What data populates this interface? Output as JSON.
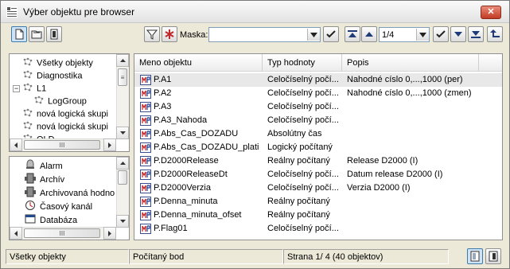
{
  "window": {
    "title": "Výber objektu pre browser",
    "close_label": "✕"
  },
  "toolbar": {
    "mask_label": "Maska:",
    "mask_value": "",
    "page_value": "1/4"
  },
  "tree": {
    "items": [
      {
        "label": "Všetky objekty",
        "icon": "object-group-icon"
      },
      {
        "label": "Diagnostika",
        "icon": "object-group-icon"
      },
      {
        "label": "L1",
        "icon": "object-group-icon",
        "expander": "−"
      },
      {
        "label": "LogGroup",
        "icon": "object-group-icon"
      },
      {
        "label": "nová logická skupi",
        "icon": "object-group-icon"
      },
      {
        "label": "nová logická skupi",
        "icon": "object-group-icon"
      },
      {
        "label": "OLD",
        "icon": "object-group-icon"
      }
    ]
  },
  "types": {
    "items": [
      {
        "label": "Alarm",
        "icon": "alarm-bell-icon"
      },
      {
        "label": "Archív",
        "icon": "archive-icon"
      },
      {
        "label": "Archivovaná hodno",
        "icon": "archive-value-icon"
      },
      {
        "label": "Časový kanál",
        "icon": "time-channel-icon"
      },
      {
        "label": "Databáza",
        "icon": "database-icon"
      }
    ]
  },
  "grid": {
    "columns": [
      "Meno objektu",
      "Typ hodnoty",
      "Popis"
    ],
    "rows": [
      {
        "name": "P.A1",
        "type": "Celočíselný počí...",
        "desc": "Nahodné císlo 0,...,1000 (per)"
      },
      {
        "name": "P.A2",
        "type": "Celočíselný počí...",
        "desc": "Nahodné císlo 0,...,1000 (zmen)"
      },
      {
        "name": "P.A3",
        "type": "Celočíselný počí...",
        "desc": ""
      },
      {
        "name": "P.A3_Nahoda",
        "type": "Celočíselný počí...",
        "desc": ""
      },
      {
        "name": "P.Abs_Cas_DOZADU",
        "type": "Absolútny čas",
        "desc": ""
      },
      {
        "name": "P.Abs_Cas_DOZADU_plati",
        "type": "Logický počítaný",
        "desc": ""
      },
      {
        "name": "P.D2000Release",
        "type": "Reálny počítaný",
        "desc": "Release D2000 (I)"
      },
      {
        "name": "P.D2000ReleaseDt",
        "type": "Celočíselný počí...",
        "desc": "Datum release D2000 (I)"
      },
      {
        "name": "P.D2000Verzia",
        "type": "Celočíselný počí...",
        "desc": "Verzia D2000 (I)"
      },
      {
        "name": "P.Denna_minuta",
        "type": "Reálny počítaný",
        "desc": ""
      },
      {
        "name": "P.Denna_minuta_ofset",
        "type": "Reálny počítaný",
        "desc": ""
      },
      {
        "name": "P.Flag01",
        "type": "Celočíselný počí...",
        "desc": ""
      }
    ]
  },
  "status": {
    "group": "Všetky objekty",
    "type": "Počítaný bod",
    "page_info": "Strana  1/ 4     (40 objektov)"
  }
}
